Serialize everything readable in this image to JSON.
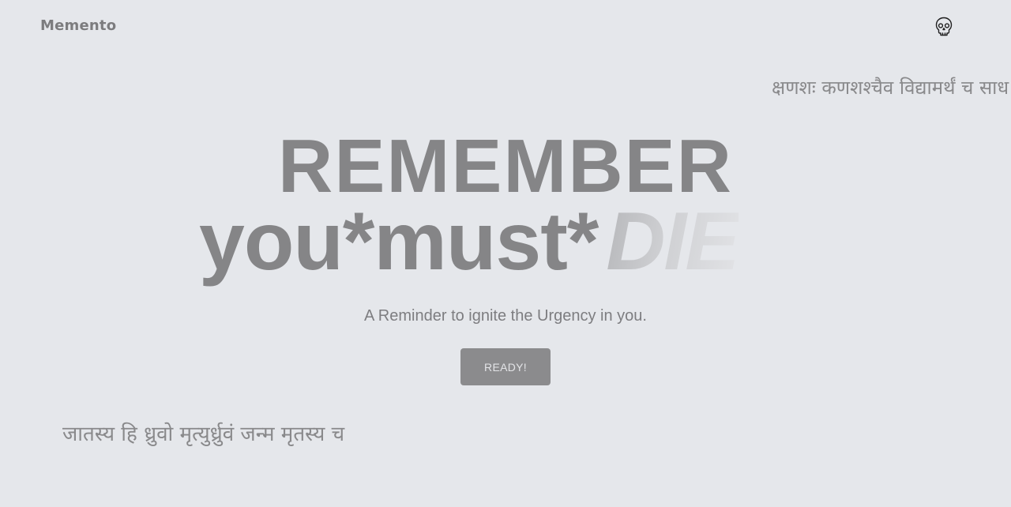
{
  "header": {
    "brand": "Memento",
    "skull_icon": "skull-icon"
  },
  "hero": {
    "line1": "REMEMBER",
    "line2_main": "you*must*",
    "line2_accent": "DIE",
    "tagline": "A Reminder to ignite the Urgency in you.",
    "cta_label": "READY!"
  },
  "verses": {
    "top": "क्षणशः कणशश्चैव विद्यामर्थं च साध",
    "bottom": "जातस्य हि ध्रुवो मृत्युर्ध्रुवं जन्म मृतस्य च"
  },
  "colors": {
    "background": "#e5e7eb",
    "text": "#858587",
    "button": "#8b8b8d"
  }
}
